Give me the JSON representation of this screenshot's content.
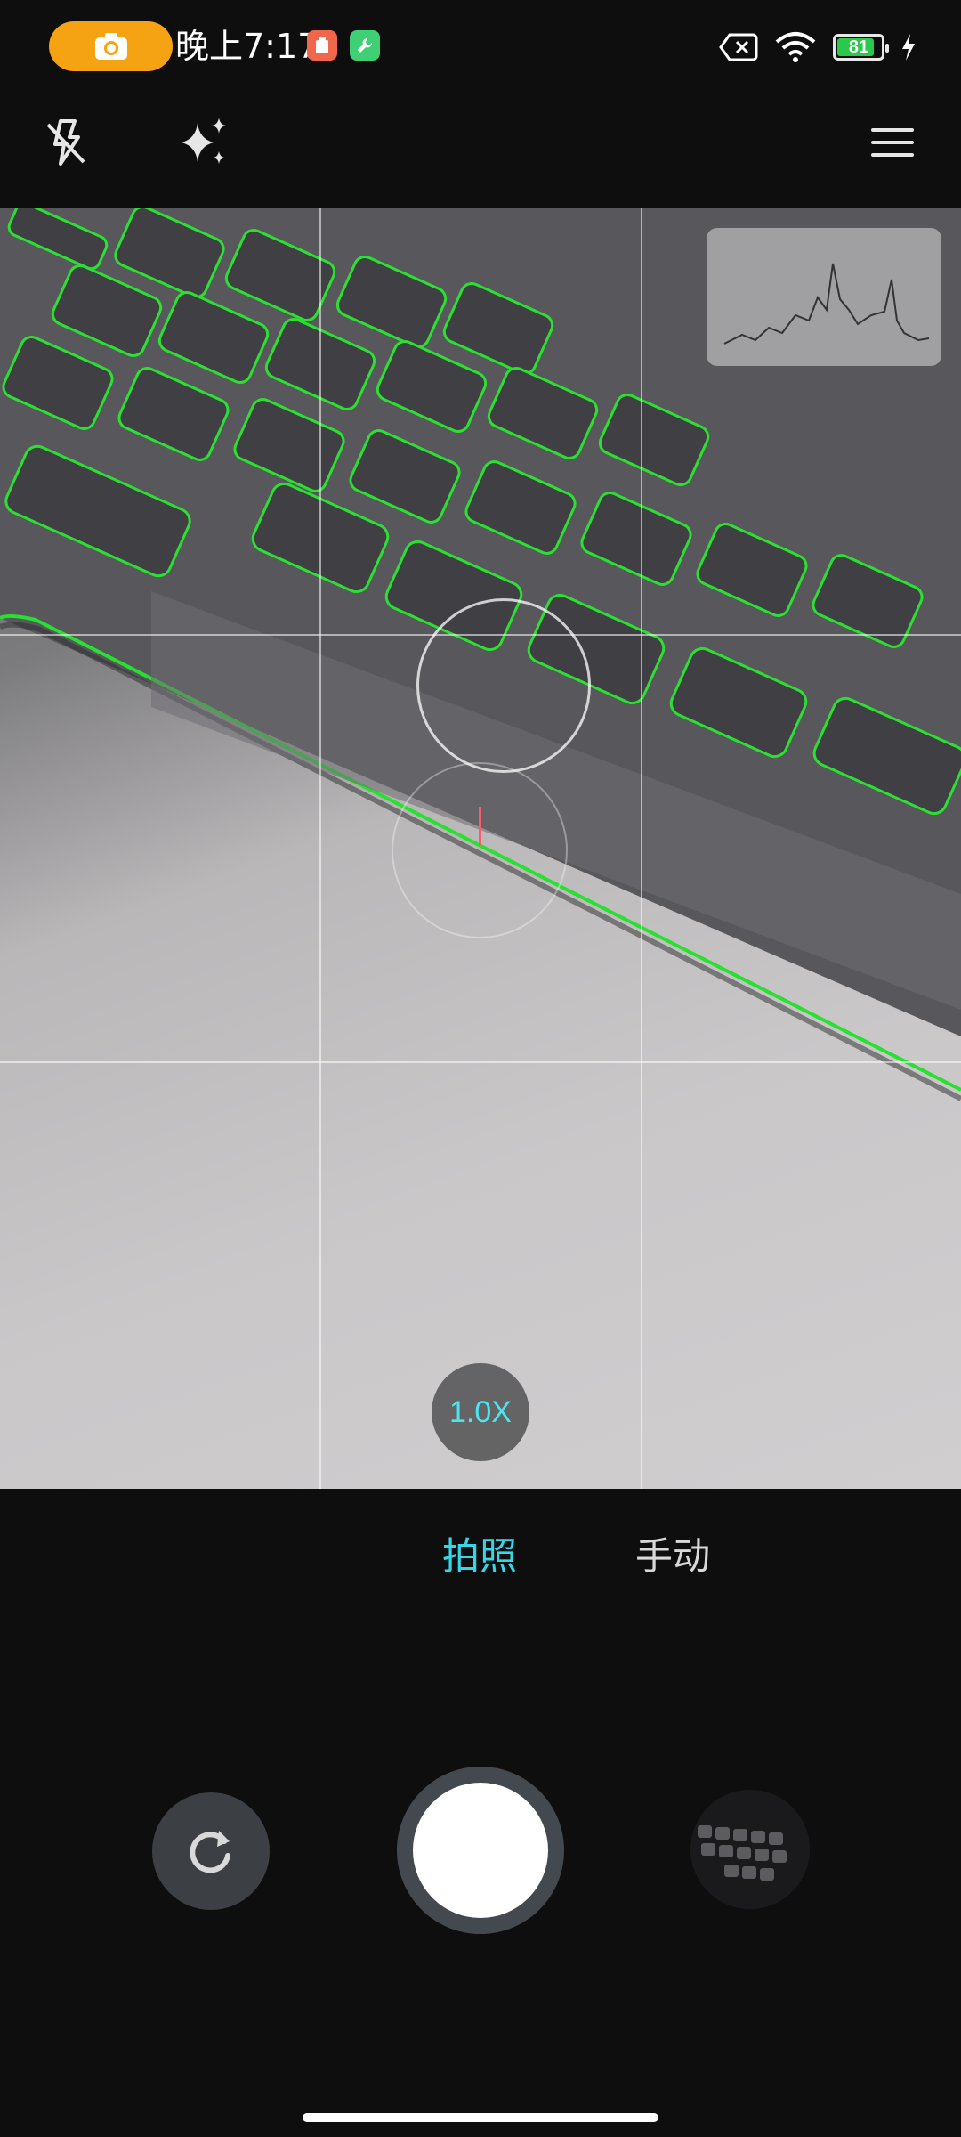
{
  "status_bar": {
    "time": "晚上7:17",
    "battery_level": "81",
    "icons": [
      "camera-icon",
      "app-notification-icon",
      "app-tool-icon",
      "sim-off-icon",
      "wifi-icon",
      "battery-icon",
      "charging-icon"
    ]
  },
  "toolbar": {
    "icons": [
      "flash-off-icon",
      "ai-enhance-icon",
      "menu-icon"
    ]
  },
  "viewfinder": {
    "zoom_label": "1.0X"
  },
  "modes": {
    "photo": "拍照",
    "manual": "手动",
    "active": "拍照"
  },
  "colors": {
    "accent": "#35d6e6",
    "recording_pill": "#f6a313",
    "background": "#0e0e0f"
  }
}
